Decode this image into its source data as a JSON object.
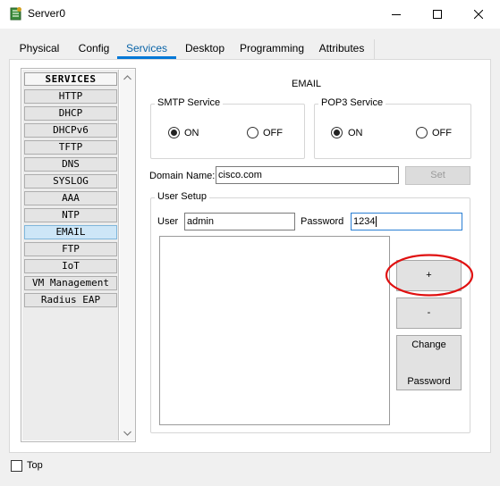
{
  "window": {
    "title": "Server0",
    "icons": {
      "app": "server-app-icon",
      "minimize": "minimize-icon",
      "maximize": "maximize-icon",
      "close": "close-icon"
    }
  },
  "tabs": [
    {
      "label": "Physical",
      "active": false
    },
    {
      "label": "Config",
      "active": false
    },
    {
      "label": "Services",
      "active": true
    },
    {
      "label": "Desktop",
      "active": false
    },
    {
      "label": "Programming",
      "active": false
    },
    {
      "label": "Attributes",
      "active": false
    }
  ],
  "services": {
    "header": "SERVICES",
    "items": [
      "HTTP",
      "DHCP",
      "DHCPv6",
      "TFTP",
      "DNS",
      "SYSLOG",
      "AAA",
      "NTP",
      "EMAIL",
      "FTP",
      "IoT",
      "VM Management",
      "Radius EAP"
    ],
    "selected": "EMAIL"
  },
  "email": {
    "title": "EMAIL",
    "smtp": {
      "label": "SMTP Service",
      "on_label": "ON",
      "off_label": "OFF",
      "value": "ON"
    },
    "pop3": {
      "label": "POP3 Service",
      "on_label": "ON",
      "off_label": "OFF",
      "value": "ON"
    },
    "domain": {
      "label": "Domain Name:",
      "value": "cisco.com",
      "set_label": "Set",
      "set_enabled": false
    },
    "user_setup": {
      "label": "User Setup",
      "user_label": "User",
      "user_value": "admin",
      "password_label": "Password",
      "password_value": "1234",
      "users": [],
      "add_label": "+",
      "remove_label": "-",
      "change_label_line1": "Change",
      "change_label_line2": "Password"
    }
  },
  "footer": {
    "top_label": "Top",
    "top_checked": false
  },
  "colors": {
    "accent": "#0078d7",
    "highlight": "#e01010",
    "selected_item": "#cde6f7"
  }
}
